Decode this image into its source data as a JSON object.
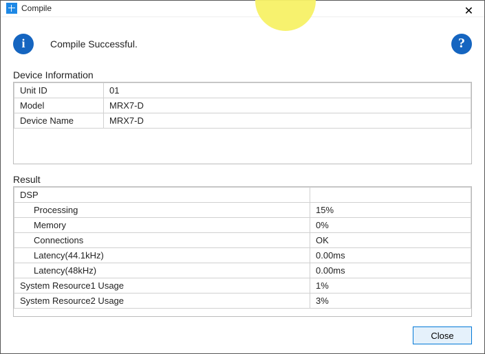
{
  "window": {
    "title": "Compile",
    "close_glyph": "✕"
  },
  "status": {
    "message": "Compile Successful.",
    "info_glyph": "i",
    "help_glyph": "?"
  },
  "device_section": {
    "title": "Device Information",
    "rows": [
      {
        "label": "Unit ID",
        "value": "01"
      },
      {
        "label": "Model",
        "value": "MRX7-D"
      },
      {
        "label": "Device Name",
        "value": "MRX7-D"
      }
    ]
  },
  "result_section": {
    "title": "Result",
    "group_label": "DSP",
    "dsp_rows": [
      {
        "label": "Processing",
        "value": "15%"
      },
      {
        "label": "Memory",
        "value": "0%"
      },
      {
        "label": "Connections",
        "value": "OK"
      },
      {
        "label": "Latency(44.1kHz)",
        "value": "0.00ms"
      },
      {
        "label": "Latency(48kHz)",
        "value": "0.00ms"
      }
    ],
    "sys_rows": [
      {
        "label": "System Resource1 Usage",
        "value": "1%"
      },
      {
        "label": "System Resource2 Usage",
        "value": "3%"
      }
    ]
  },
  "footer": {
    "close_label": "Close"
  }
}
